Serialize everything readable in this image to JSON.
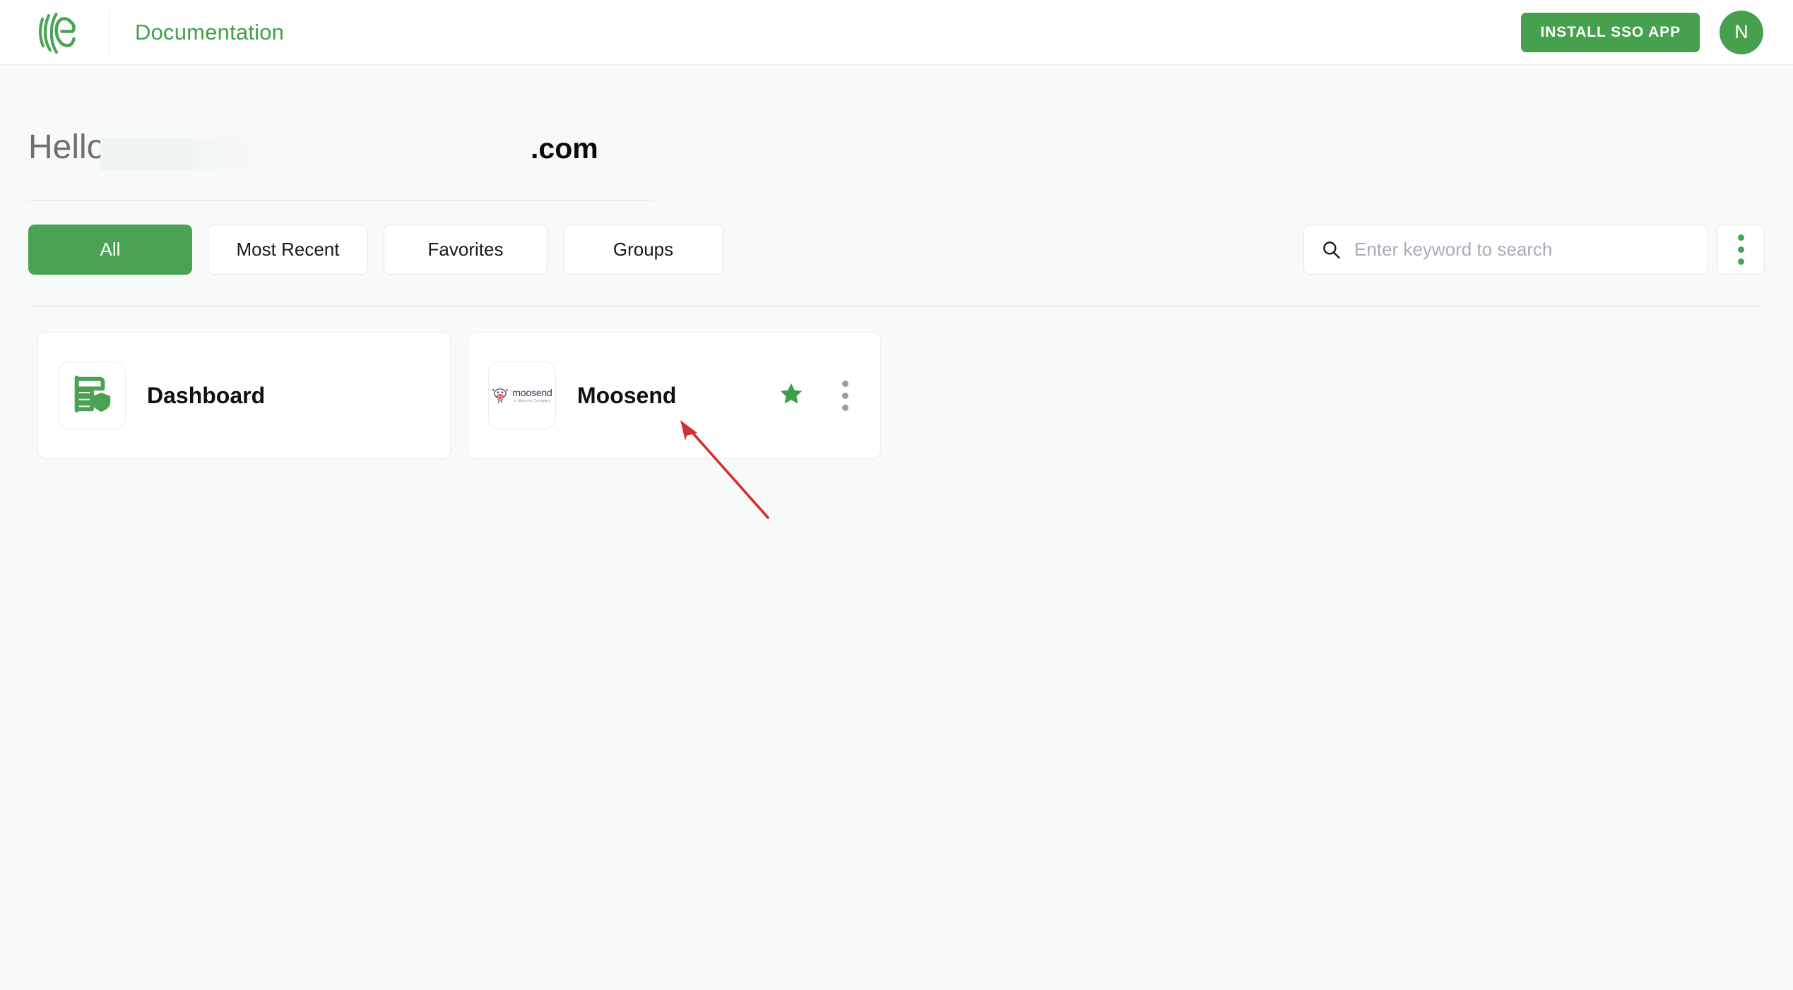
{
  "header": {
    "logo_name": "company-logo",
    "title": "Documentation",
    "install_button_label": "INSTALL SSO APP",
    "avatar_initial": "N",
    "brand_color": "#43a047",
    "button_color": "#46a04d"
  },
  "greeting": {
    "hello_text": "Hello",
    "redacted_name": "",
    "domain_suffix": ".com"
  },
  "toolbar": {
    "tabs": [
      {
        "label": "All",
        "active": true
      },
      {
        "label": "Most Recent",
        "active": false
      },
      {
        "label": "Favorites",
        "active": false
      },
      {
        "label": "Groups",
        "active": false
      }
    ],
    "search": {
      "placeholder": "Enter keyword to search",
      "value": "",
      "icon": "search-icon"
    },
    "overflow_menu_icon": "kebab-menu-icon"
  },
  "apps": [
    {
      "name": "Dashboard",
      "icon": "dashboard-shield-icon",
      "favorited": false,
      "has_menu": false
    },
    {
      "name": "Moosend",
      "icon": "moosend-logo-icon",
      "logo_word": "moosend",
      "logo_tagline": "a Sitecore Company",
      "favorited": true,
      "favorite_icon": "star-icon",
      "menu_icon": "kebab-menu-icon"
    }
  ],
  "annotation": {
    "type": "arrow",
    "color": "#d32f2f",
    "points_to": "Moosend card"
  },
  "colors": {
    "accent_green": "#46a04d",
    "star_green": "#3aa147",
    "page_background": "#f8f9f9",
    "card_background": "#ffffff",
    "annotation_red": "#d32f2f"
  }
}
